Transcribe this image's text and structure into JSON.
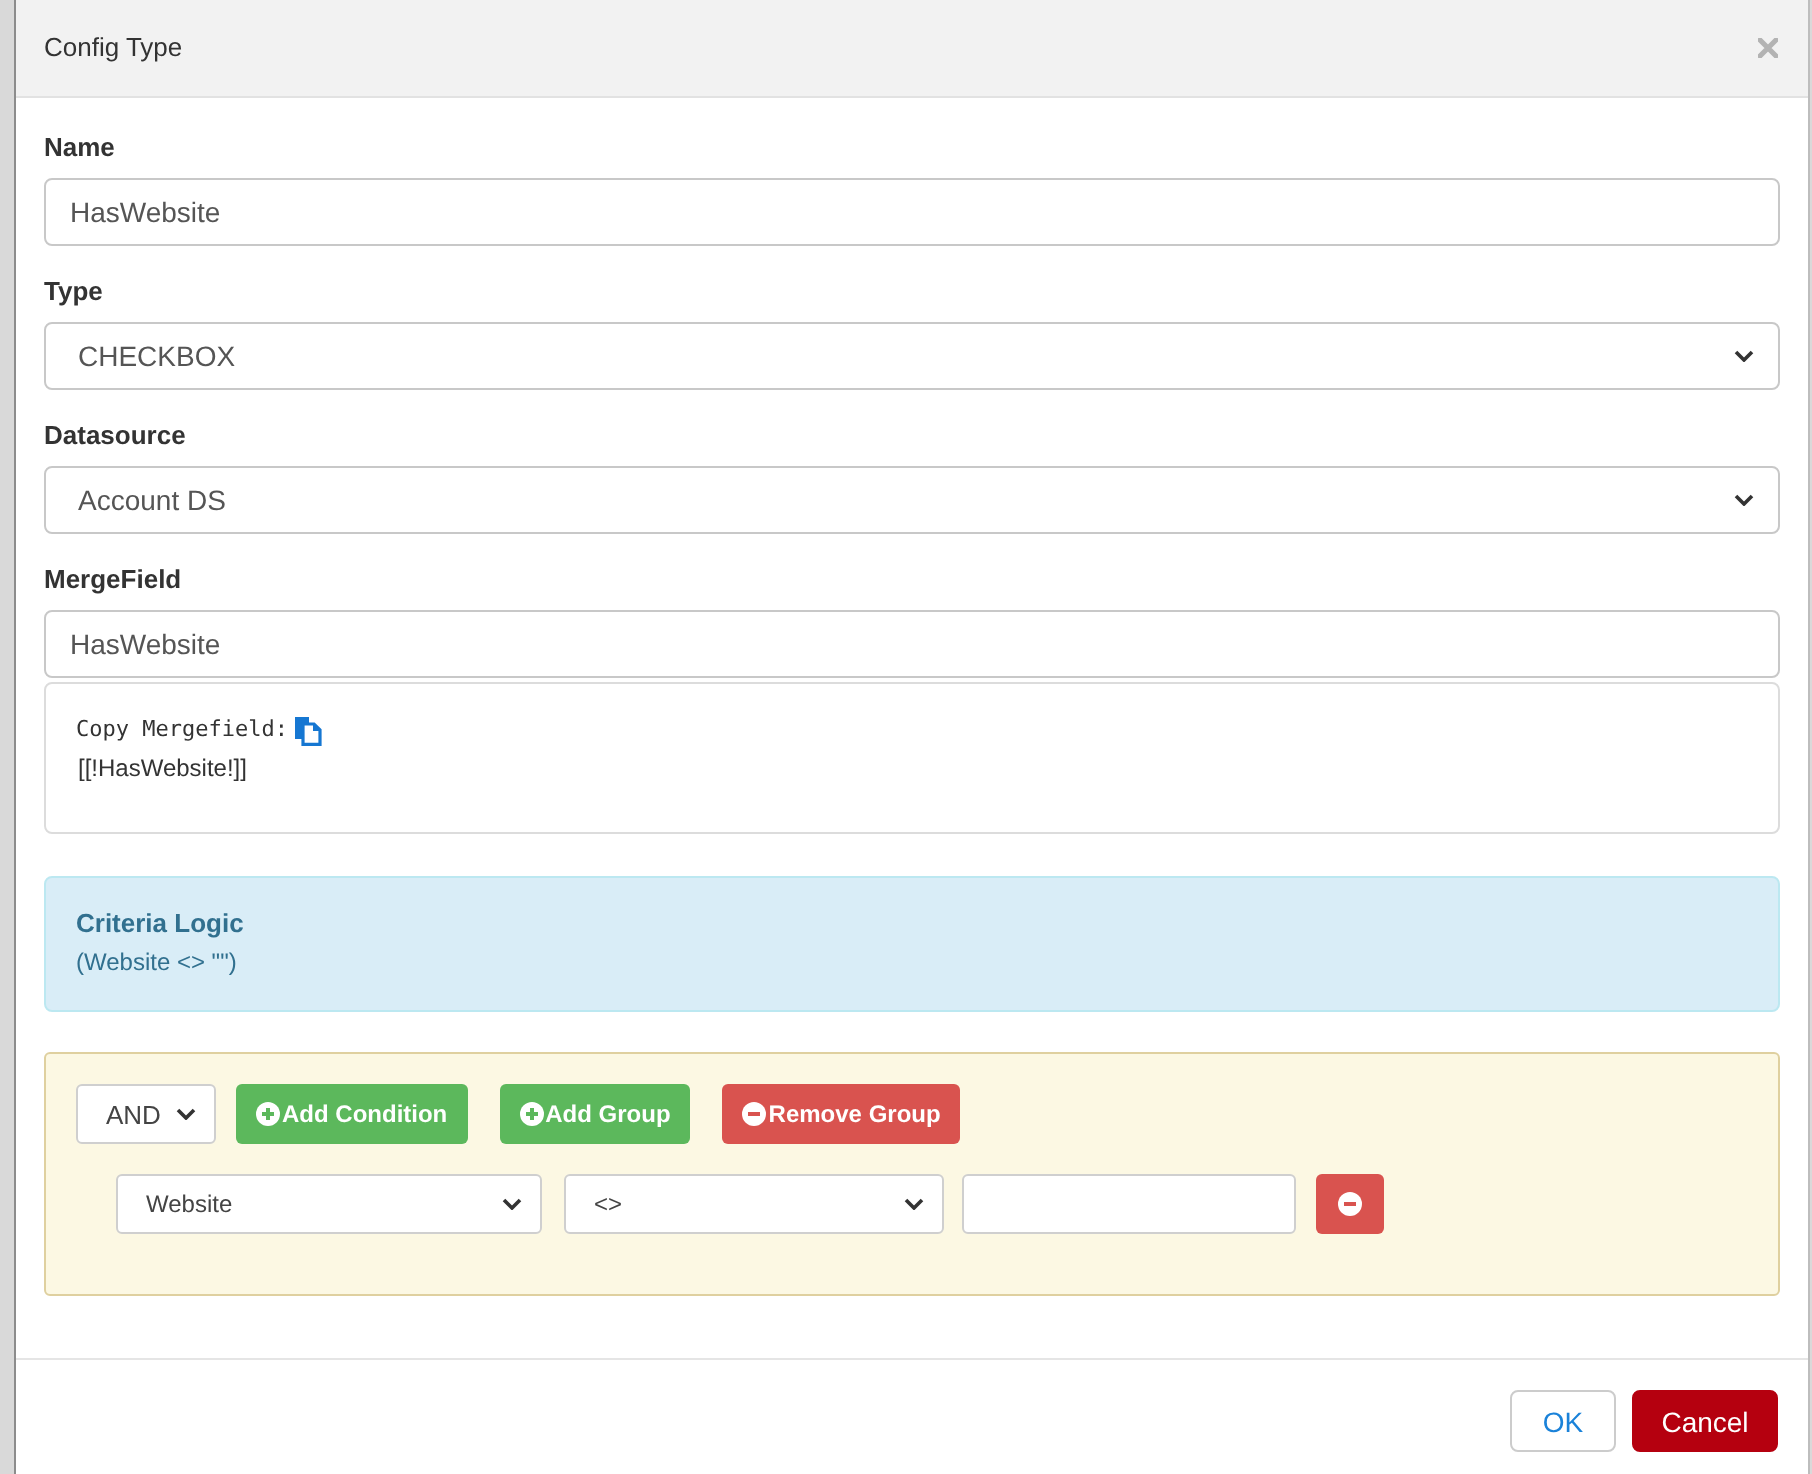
{
  "dialog": {
    "title": "Config Type"
  },
  "fields": [
    {
      "kind": "input",
      "label": "Name",
      "value": "HasWebsite"
    },
    {
      "kind": "select",
      "label": "Type",
      "value": "CHECKBOX"
    },
    {
      "kind": "select",
      "label": "Datasource",
      "value": "Account DS"
    },
    {
      "kind": "input",
      "label": "MergeField",
      "value": "HasWebsite"
    }
  ],
  "mergefield_copy": {
    "label": "Copy Mergefield:",
    "token": "[[!HasWebsite!]]"
  },
  "criteria_logic": {
    "title": "Criteria Logic",
    "expression": "(Website <> \"\")"
  },
  "query_builder": {
    "conjunction": "AND",
    "buttons": [
      {
        "kind": "add",
        "label": "Add Condition"
      },
      {
        "kind": "add",
        "label": "Add Group"
      },
      {
        "kind": "remove",
        "label": "Remove Group"
      }
    ],
    "rules": [
      {
        "field": "Website",
        "operator": "<>"
      }
    ]
  },
  "footer": {
    "buttons": [
      {
        "kind": "default",
        "label": "OK"
      },
      {
        "kind": "danger",
        "label": "Cancel"
      }
    ]
  }
}
